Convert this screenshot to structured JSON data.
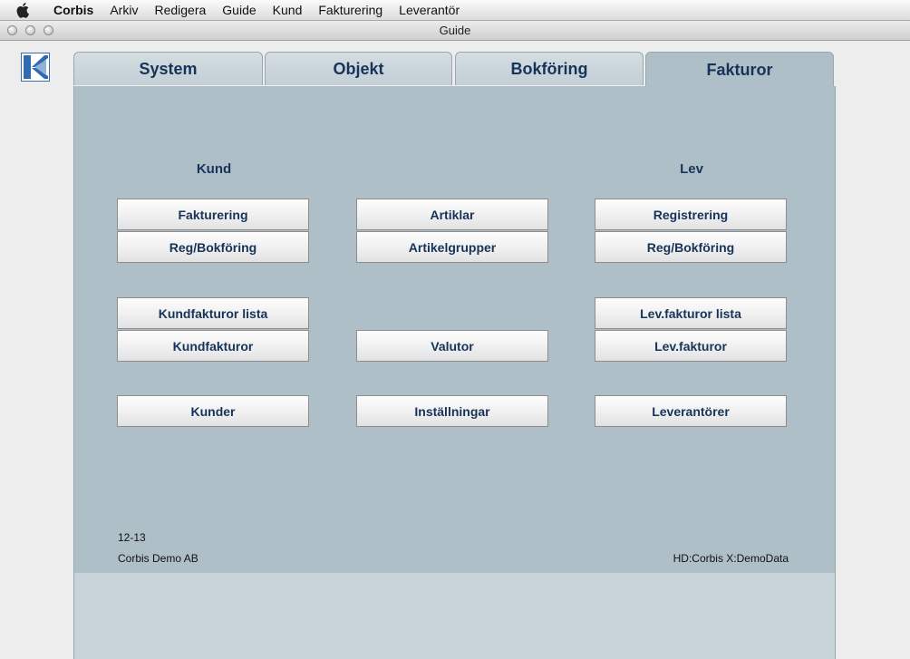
{
  "menubar": {
    "app": "Corbis",
    "items": [
      "Arkiv",
      "Redigera",
      "Guide",
      "Kund",
      "Fakturering",
      "Leverantör"
    ]
  },
  "window": {
    "title": "Guide"
  },
  "tabs": [
    {
      "label": "System",
      "active": false
    },
    {
      "label": "Objekt",
      "active": false
    },
    {
      "label": "Bokföring",
      "active": false
    },
    {
      "label": "Fakturor",
      "active": true
    }
  ],
  "panel": {
    "headings": {
      "kund": "Kund",
      "lev": "Lev"
    },
    "buttons": {
      "fakturering": "Fakturering",
      "kund_reg_bokforing": "Reg/Bokföring",
      "artiklar": "Artiklar",
      "artikelgrupper": "Artikelgrupper",
      "registrering": "Registrering",
      "lev_reg_bokforing": "Reg/Bokföring",
      "kundfakturor_lista": "Kundfakturor lista",
      "kundfakturor": "Kundfakturor",
      "valutor": "Valutor",
      "levfakturor_lista": "Lev.fakturor lista",
      "levfakturor": "Lev.fakturor",
      "kunder": "Kunder",
      "installningar": "Inställningar",
      "leverantorer": "Leverantörer"
    },
    "footer": {
      "period": "12-13",
      "company": "Corbis Demo AB",
      "datapath": "HD:Corbis X:DemoData"
    }
  },
  "colors": {
    "panel": "#aebfc7",
    "text": "#17335a",
    "lower_panel": "#c8d4da"
  }
}
